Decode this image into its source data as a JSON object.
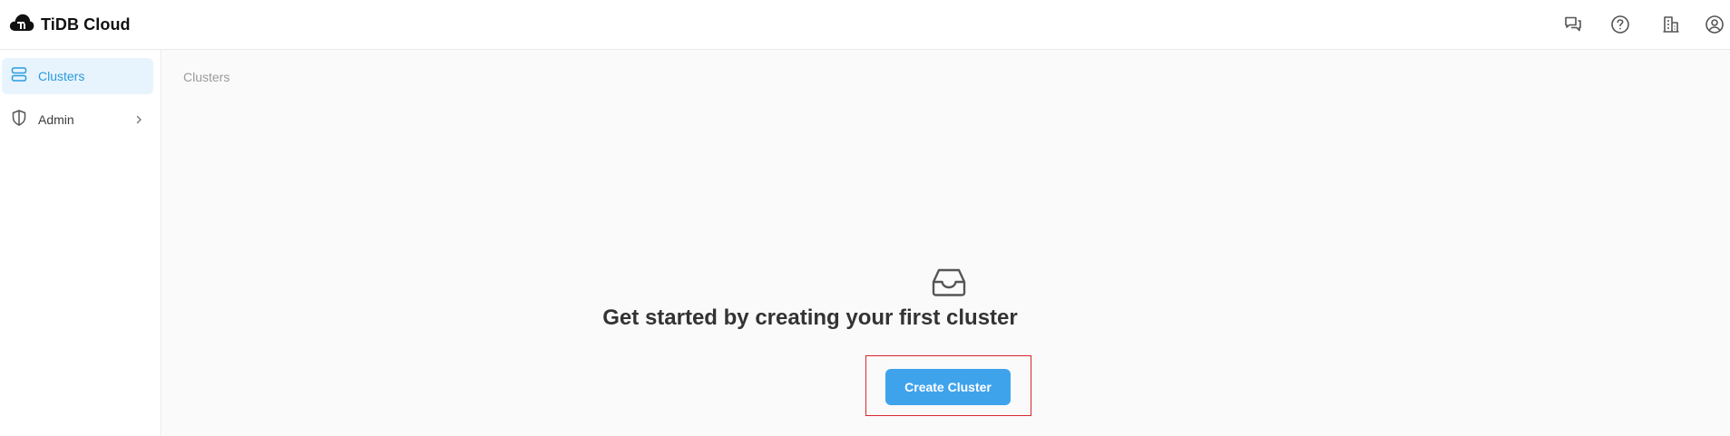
{
  "header": {
    "title": "TiDB Cloud",
    "logo_icon": "tidb-cloud-logo-icon",
    "icons": [
      "chat-icon",
      "help-icon",
      "organization-icon",
      "account-icon"
    ]
  },
  "sidebar": {
    "items": [
      {
        "label": "Clusters",
        "icon": "clusters-icon",
        "active": true
      },
      {
        "label": "Admin",
        "icon": "shield-icon",
        "active": false
      }
    ]
  },
  "main": {
    "breadcrumb": "Clusters",
    "empty_state": {
      "icon": "inbox-icon",
      "title": "Get started by creating your first cluster",
      "button_label": "Create Cluster"
    }
  },
  "colors": {
    "accent": "#3fa3ec",
    "active_bg": "#e8f4fd",
    "highlight_border": "#d9262c"
  }
}
